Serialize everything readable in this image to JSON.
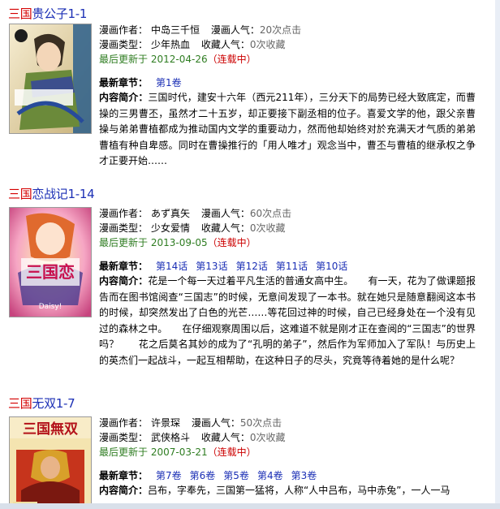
{
  "labels": {
    "author": "漫画作者：",
    "popularity": "漫画人气：",
    "genre": "漫画类型：",
    "favorites": "收藏人气：",
    "updated": "最后更新于",
    "latest": "最新章节：",
    "summary": "内容简介："
  },
  "items": [
    {
      "title_red": "三国",
      "title_blue": "贵公子1-1",
      "author": "中岛三千恒",
      "popularity": "20次点击",
      "genre": "少年热血",
      "favorites": "0次收藏",
      "date": "2012-04-26",
      "status": "（连载中）",
      "chapters": [
        "第1卷"
      ],
      "summary": "三国时代，建安十六年（西元211年），三分天下的局势已经大致底定，而曹操的三男曹丕，虽然才二十五岁，却正要接下副丞相的位子。喜爱文学的他，跟父亲曹操与弟弟曹植都成为推动国内文学的重要动力，然而他却始终对於充满天才气质的弟弟曹植有种自卑感。同时在曹操推行的「用人唯才」观念当中，曹丕与曹植的继承权之争才正要开始……"
    },
    {
      "title_red": "三国",
      "title_blue": "恋战记1-14",
      "author": "あず真矢",
      "popularity": "60次点击",
      "genre": "少女爱情",
      "favorites": "0次收藏",
      "date": "2013-09-05",
      "status": "（连载中）",
      "chapters": [
        "第14话",
        "第13话",
        "第12话",
        "第11话",
        "第10话"
      ],
      "summary": "花是一个每一天过着平凡生活的普通女高中生。　　有一天，花为了做课题报告而在图书馆阅查“三国志”的时候，无意间发现了一本书。就在她只是随意翻阅这本书的时候，却突然发出了白色的光芒……等花回过神的时候，自己已经身处在一个没有见过的森林之中。　　在仔细观察周围以后，这难道不就是刚才正在查阅的“三国志”的世界吗？　　花之后莫名其妙的成为了“孔明的弟子”，然后作为军师加入了军队！与历史上的英杰们一起战斗，一起互相帮助，在这种日子的尽头，究竟等待着她的是什么呢？"
    },
    {
      "title_red": "三国",
      "title_blue": "无双1-7",
      "author": "许景琛",
      "popularity": "50次点击",
      "genre": "武侠格斗",
      "favorites": "0次收藏",
      "date": "2007-03-21",
      "status": "（连载中）",
      "chapters": [
        "第7卷",
        "第6卷",
        "第5卷",
        "第4卷",
        "第3卷"
      ],
      "summary": "吕布，字奉先，三国第一猛将，人称“人中吕布，马中赤兔”，一人一马"
    }
  ],
  "cover_text": {
    "cover2_badge": "Daisy!"
  }
}
